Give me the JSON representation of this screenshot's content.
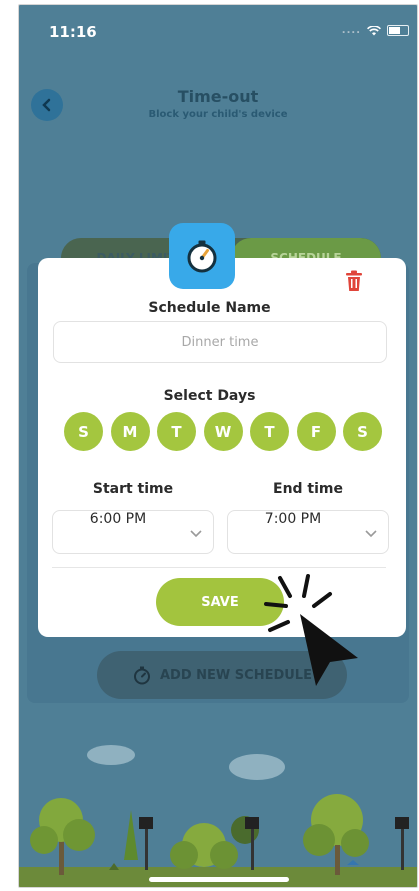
{
  "status_bar": {
    "time": "11:16",
    "signal": "...."
  },
  "header": {
    "title": "Time-out",
    "subtitle": "Block your child's device"
  },
  "background": {
    "tab_left": "DAILY LIMIT",
    "tab_right": "SCHEDULE",
    "add_schedule_label": "ADD NEW SCHEDULE"
  },
  "modal": {
    "schedule_name_label": "Schedule Name",
    "schedule_name_placeholder": "Dinner time",
    "schedule_name_value": "",
    "select_days_label": "Select Days",
    "days": [
      "S",
      "M",
      "T",
      "W",
      "T",
      "F",
      "S"
    ],
    "start_time_label": "Start time",
    "start_time_value": "6:00 PM",
    "end_time_label": "End time",
    "end_time_value": "7:00 PM",
    "save_label": "SAVE"
  },
  "icons": {
    "modal_icon": "stopwatch-icon",
    "delete": "trash-icon",
    "back": "chevron-left-icon",
    "dropdown": "chevron-down-icon"
  },
  "colors": {
    "accent_green": "#a4c63f",
    "accent_blue": "#38a9e9",
    "delete_red": "#e0453a",
    "background": "#4f7f96"
  }
}
